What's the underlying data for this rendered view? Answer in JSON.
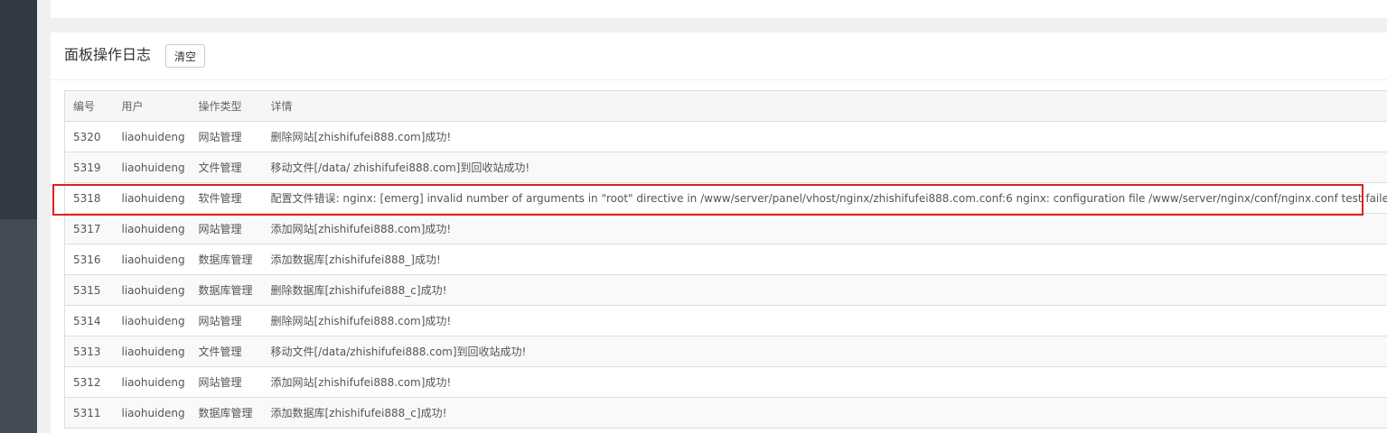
{
  "panel": {
    "title": "面板操作日志",
    "clear_label": "清空"
  },
  "table": {
    "headers": [
      "编号",
      "用户",
      "操作类型",
      "详情"
    ],
    "rows": [
      {
        "id": "5320",
        "user": "liaohuideng",
        "type": "网站管理",
        "detail": "删除网站[zhishifufei888.com]成功!"
      },
      {
        "id": "5319",
        "user": "liaohuideng",
        "type": "文件管理",
        "detail": "移动文件[/data/ zhishifufei888.com]到回收站成功!"
      },
      {
        "id": "5318",
        "user": "liaohuideng",
        "type": "软件管理",
        "detail": "配置文件错误: nginx: [emerg] invalid number of arguments in \"root\" directive in /www/server/panel/vhost/nginx/zhishifufei888.com.conf:6 nginx: configuration file /www/server/nginx/conf/nginx.conf test failed"
      },
      {
        "id": "5317",
        "user": "liaohuideng",
        "type": "网站管理",
        "detail": "添加网站[zhishifufei888.com]成功!"
      },
      {
        "id": "5316",
        "user": "liaohuideng",
        "type": "数据库管理",
        "detail": "添加数据库[zhishifufei888_]成功!"
      },
      {
        "id": "5315",
        "user": "liaohuideng",
        "type": "数据库管理",
        "detail": "删除数据库[zhishifufei888_c]成功!"
      },
      {
        "id": "5314",
        "user": "liaohuideng",
        "type": "网站管理",
        "detail": "删除网站[zhishifufei888.com]成功!"
      },
      {
        "id": "5313",
        "user": "liaohuideng",
        "type": "文件管理",
        "detail": "移动文件[/data/zhishifufei888.com]到回收站成功!"
      },
      {
        "id": "5312",
        "user": "liaohuideng",
        "type": "网站管理",
        "detail": "添加网站[zhishifufei888.com]成功!"
      },
      {
        "id": "5311",
        "user": "liaohuideng",
        "type": "数据库管理",
        "detail": "添加数据库[zhishifufei888_c]成功!"
      }
    ]
  },
  "highlight": {
    "row_id": "5318",
    "color": "#e02020"
  }
}
